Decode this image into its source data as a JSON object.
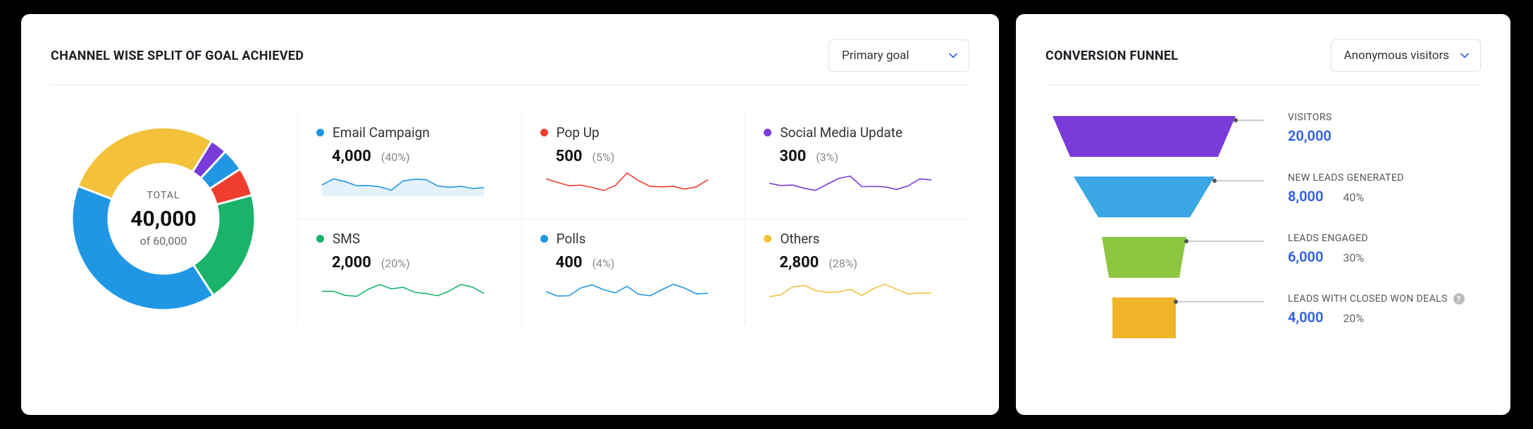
{
  "left": {
    "title": "CHANNEL WISE SPLIT OF GOAL ACHIEVED",
    "goal_select": "Primary goal",
    "donut": {
      "total_label": "TOTAL",
      "total_value": "40,000",
      "total_sub": "of 60,000"
    },
    "channels": [
      {
        "name": "Email Campaign",
        "value": "4,000",
        "pct": "(40%)",
        "color": "#1f97e5"
      },
      {
        "name": "Pop Up",
        "value": "500",
        "pct": "(5%)",
        "color": "#ef3d2f"
      },
      {
        "name": "Social Media Update",
        "value": "300",
        "pct": "(3%)",
        "color": "#7a3bd8"
      },
      {
        "name": "SMS",
        "value": "2,000",
        "pct": "(20%)",
        "color": "#19b36a"
      },
      {
        "name": "Polls",
        "value": "400",
        "pct": "(4%)",
        "color": "#1f97e5"
      },
      {
        "name": "Others",
        "value": "2,800",
        "pct": "(28%)",
        "color": "#f3c13a"
      }
    ]
  },
  "right": {
    "title": "CONVERSION FUNNEL",
    "select": "Anonymous visitors",
    "stages": [
      {
        "title": "VISITORS",
        "value": "20,000",
        "pct": "",
        "color": "#7a3bd8"
      },
      {
        "title": "NEW LEADS GENERATED",
        "value": "8,000",
        "pct": "40%",
        "color": "#3aa7e4"
      },
      {
        "title": "LEADS ENGAGED",
        "value": "6,000",
        "pct": "30%",
        "color": "#8dc641"
      },
      {
        "title": "LEADS WITH CLOSED WON DEALS",
        "value": "4,000",
        "pct": "20%",
        "color": "#f0b428",
        "help": true
      }
    ]
  },
  "chart_data": [
    {
      "type": "pie",
      "title": "Channel Wise Split of Goal Achieved",
      "total": 40000,
      "of": 60000,
      "series": [
        {
          "name": "Email Campaign",
          "value": 4000,
          "pct": 40
        },
        {
          "name": "Pop Up",
          "value": 500,
          "pct": 5
        },
        {
          "name": "Social Media Update",
          "value": 300,
          "pct": 3
        },
        {
          "name": "SMS",
          "value": 2000,
          "pct": 20
        },
        {
          "name": "Polls",
          "value": 400,
          "pct": 4
        },
        {
          "name": "Others",
          "value": 2800,
          "pct": 28
        }
      ]
    },
    {
      "type": "bar",
      "title": "Conversion Funnel",
      "categories": [
        "Visitors",
        "New Leads Generated",
        "Leads Engaged",
        "Leads With Closed Won Deals"
      ],
      "values": [
        20000,
        8000,
        6000,
        4000
      ],
      "pct_of_visitors": [
        100,
        40,
        30,
        20
      ]
    }
  ]
}
